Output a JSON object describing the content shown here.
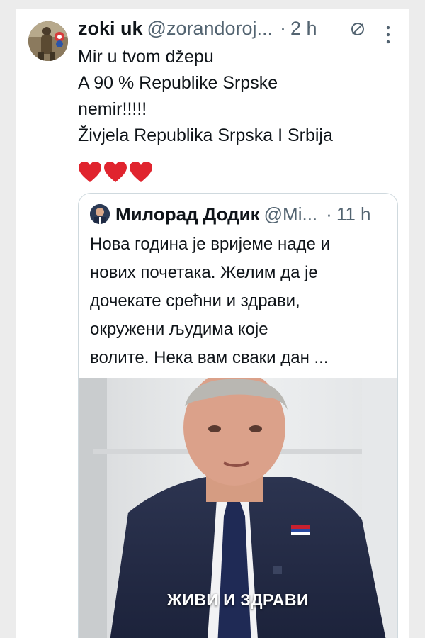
{
  "tweet": {
    "author_name": "zoki uk",
    "author_handle": "@zorandoroj...",
    "separator": "·",
    "time": "2 h",
    "lines": [
      "Mir u tvom džepu",
      "A  90 % Republike Srpske",
      "nemir!!!!!",
      "Živjela Republika Srpska I Srbija"
    ],
    "emoji": [
      "heart",
      "heart",
      "heart"
    ]
  },
  "quoted": {
    "author_name": "Милорад Додик",
    "author_handle": "@Mi...",
    "separator": "·",
    "time": "11 h",
    "lines": [
      "Нова година је вријеме наде и",
      "нових почетака. Желим да је",
      "дочекате срећни и здрави,",
      "окружени људима које",
      "волите. Нека вам сваки дан ..."
    ],
    "media_caption": "ЖИВИ И ЗДРАВИ"
  },
  "colors": {
    "text_primary": "#0f1419",
    "text_secondary": "#536471",
    "heart": "#e0242e",
    "border": "#cfd9de"
  }
}
